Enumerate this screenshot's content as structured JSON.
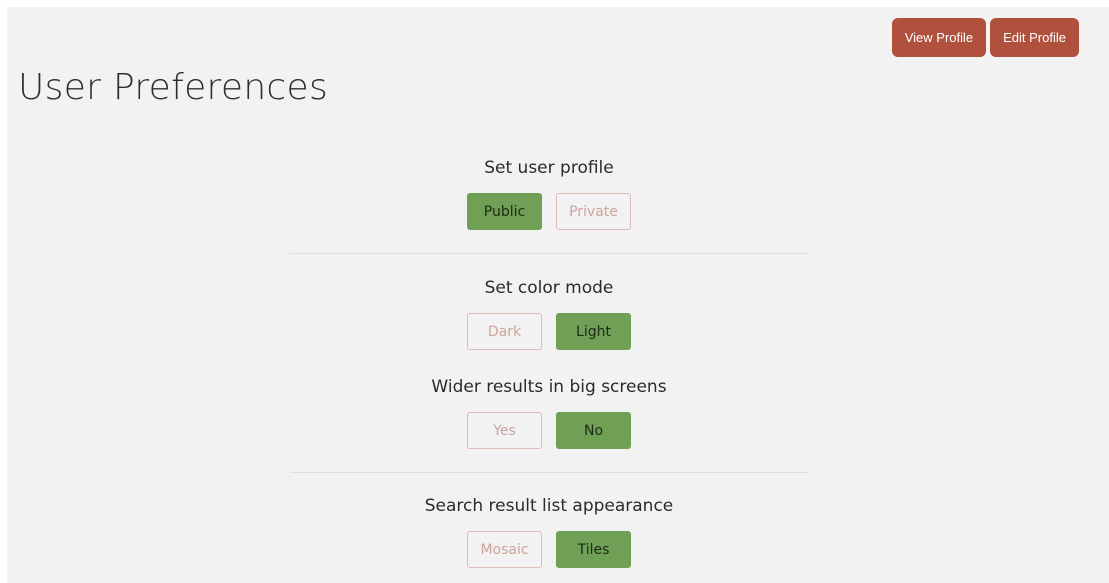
{
  "header": {
    "view_profile_label": "View Profile",
    "edit_profile_label": "Edit Profile"
  },
  "page": {
    "title": "User Preferences"
  },
  "sections": {
    "profile": {
      "label": "Set user profile",
      "options": [
        "Public",
        "Private"
      ],
      "selected": "Public"
    },
    "color_mode": {
      "label": "Set color mode",
      "options": [
        "Dark",
        "Light"
      ],
      "selected": "Light"
    },
    "wider_results": {
      "label": "Wider results in big screens",
      "options": [
        "Yes",
        "No"
      ],
      "selected": "No"
    },
    "list_appearance": {
      "label": "Search result list appearance",
      "options": [
        "Mosaic",
        "Tiles"
      ],
      "selected": "Tiles"
    }
  },
  "colors": {
    "header_button": "#b0513d",
    "selected_toggle": "#6fa055",
    "unselected_border": "#dcbcb4",
    "unselected_text": "#cba49a",
    "panel_background": "#f2f2f2"
  }
}
